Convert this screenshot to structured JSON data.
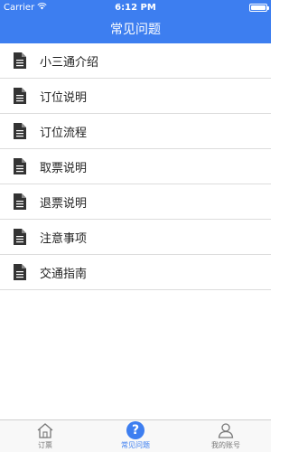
{
  "status_bar": {
    "carrier": "Carrier",
    "time": "6:12 PM",
    "battery_level": 1.0
  },
  "nav": {
    "title": "常见问题"
  },
  "faq_list": [
    {
      "label": "小三通介绍",
      "icon": "document-icon"
    },
    {
      "label": "订位说明",
      "icon": "document-icon"
    },
    {
      "label": "订位流程",
      "icon": "document-icon"
    },
    {
      "label": "取票说明",
      "icon": "document-icon"
    },
    {
      "label": "退票说明",
      "icon": "document-icon"
    },
    {
      "label": "注意事项",
      "icon": "document-icon"
    },
    {
      "label": "交通指南",
      "icon": "document-icon"
    }
  ],
  "tabs": [
    {
      "label": "订票",
      "icon": "home-icon",
      "active": false
    },
    {
      "label": "常见问题",
      "icon": "help-icon",
      "active": true
    },
    {
      "label": "我的账号",
      "icon": "user-icon",
      "active": false
    }
  ],
  "colors": {
    "accent": "#3d7ef0",
    "divider": "#dcdcdc",
    "tab_inactive": "#777777"
  }
}
